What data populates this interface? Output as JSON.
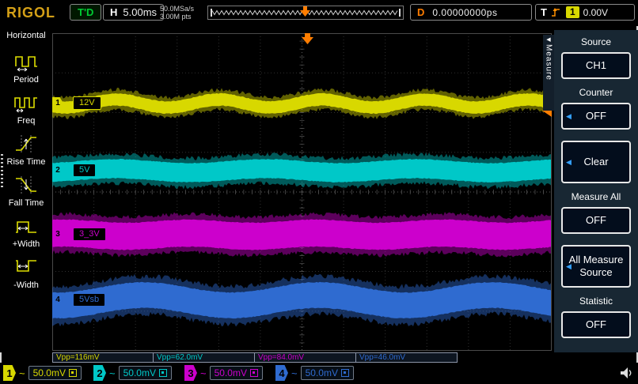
{
  "brand": "RIGOL",
  "top_bar": {
    "trigger_status": "T'D",
    "h_label": "H",
    "timebase": "5.00ms",
    "sample_rate": "50.0MSa/s",
    "memory_depth": "3.00M pts",
    "d_label": "D",
    "delay": "0.00000000ps",
    "t_label": "T",
    "trigger_source": "1",
    "trigger_level": "0.00V"
  },
  "left_menu": {
    "title": "Horizontal",
    "items": [
      {
        "label": "Period",
        "icon": "period-icon"
      },
      {
        "label": "Freq",
        "icon": "freq-icon"
      },
      {
        "label": "Rise Time",
        "icon": "rise-time-icon"
      },
      {
        "label": "Fall Time",
        "icon": "fall-time-icon"
      },
      {
        "label": "+Width",
        "icon": "plus-width-icon"
      },
      {
        "label": "-Width",
        "icon": "minus-width-icon"
      }
    ]
  },
  "right_menu": {
    "tab": "Measure",
    "source_title": "Source",
    "source_value": "CH1",
    "counter_title": "Counter",
    "counter_value": "OFF",
    "clear_label": "Clear",
    "measure_all_title": "Measure All",
    "measure_all_value": "OFF",
    "all_measure_line1": "All Measure",
    "all_measure_line2": "Source",
    "statistic_title": "Statistic",
    "statistic_value": "OFF"
  },
  "channels": [
    {
      "num": "1",
      "label": "12V",
      "coupling": "~",
      "scale": "50.0mV",
      "vpp": "Vpp=116mV",
      "color": "#d8d800"
    },
    {
      "num": "2",
      "label": "5V",
      "coupling": "~",
      "scale": "50.0mV",
      "vpp": "Vpp=62.0mV",
      "color": "#00c8c8"
    },
    {
      "num": "3",
      "label": "3_3V",
      "coupling": "~",
      "scale": "50.0mV",
      "vpp": "Vpp=84.0mV",
      "color": "#cc00cc"
    },
    {
      "num": "4",
      "label": "5Vsb",
      "coupling": "~",
      "scale": "50.0mV",
      "vpp": "Vpp=46.0mV",
      "color": "#2f6bd0"
    }
  ],
  "colors": {
    "accent_orange": "#ff7d00",
    "status_green": "#00cc33",
    "grid": "#2f2f2f",
    "grid_center": "#5a5a5a"
  }
}
